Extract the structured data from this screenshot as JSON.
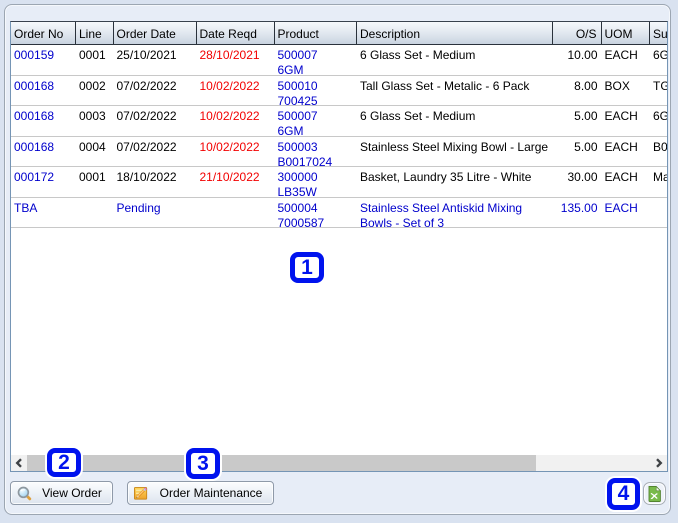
{
  "colors": {
    "outer_bg": "#d9e2f0",
    "panel_bg": "#e7edf7",
    "link_blue": "#0000cc",
    "overdue_red": "#f20000",
    "annotation_blue": "#0013ee",
    "excel_green": "#74b84a"
  },
  "grid": {
    "columns": [
      {
        "label": "Order No"
      },
      {
        "label": "Line"
      },
      {
        "label": "Order Date"
      },
      {
        "label": "Date Reqd"
      },
      {
        "label": "Product"
      },
      {
        "label": "Description"
      },
      {
        "label": "O/S",
        "align": "right"
      },
      {
        "label": "UOM"
      },
      {
        "label": "Su"
      }
    ],
    "rows": [
      {
        "cells": [
          {
            "t": "000159",
            "c": "blue"
          },
          {
            "t": "0001"
          },
          {
            "t": "25/10/2021"
          },
          {
            "t": "28/10/2021",
            "c": "red"
          },
          {
            "t": "500007\n6GM",
            "c": "blue"
          },
          {
            "t": "6 Glass Set - Medium"
          },
          {
            "t": "10.00"
          },
          {
            "t": "EACH"
          },
          {
            "t": "6G"
          }
        ]
      },
      {
        "cells": [
          {
            "t": "000168",
            "c": "blue"
          },
          {
            "t": "0002"
          },
          {
            "t": "07/02/2022"
          },
          {
            "t": "10/02/2022",
            "c": "red"
          },
          {
            "t": "500010\n700425",
            "c": "blue"
          },
          {
            "t": "Tall Glass Set - Metalic - 6 Pack"
          },
          {
            "t": "8.00"
          },
          {
            "t": "BOX"
          },
          {
            "t": "TG"
          }
        ]
      },
      {
        "cells": [
          {
            "t": "000168",
            "c": "blue"
          },
          {
            "t": "0003"
          },
          {
            "t": "07/02/2022"
          },
          {
            "t": "10/02/2022",
            "c": "red"
          },
          {
            "t": "500007\n6GM",
            "c": "blue"
          },
          {
            "t": "6 Glass Set - Medium"
          },
          {
            "t": "5.00"
          },
          {
            "t": "EACH"
          },
          {
            "t": "6G"
          }
        ]
      },
      {
        "cells": [
          {
            "t": "000168",
            "c": "blue"
          },
          {
            "t": "0004"
          },
          {
            "t": "07/02/2022"
          },
          {
            "t": "10/02/2022",
            "c": "red"
          },
          {
            "t": "500003\nB0017024",
            "c": "blue"
          },
          {
            "t": "Stainless Steel Mixing Bowl - Large"
          },
          {
            "t": "5.00"
          },
          {
            "t": "EACH"
          },
          {
            "t": "B0"
          }
        ]
      },
      {
        "cells": [
          {
            "t": "000172",
            "c": "blue"
          },
          {
            "t": "0001"
          },
          {
            "t": "18/10/2022"
          },
          {
            "t": "21/10/2022",
            "c": "red"
          },
          {
            "t": "300000\nLB35W",
            "c": "blue"
          },
          {
            "t": "Basket, Laundry 35 Litre - White"
          },
          {
            "t": "30.00"
          },
          {
            "t": "EACH"
          },
          {
            "t": "Ma"
          }
        ]
      },
      {
        "all_blue": true,
        "cells": [
          {
            "t": "TBA",
            "c": "blue"
          },
          {
            "t": ""
          },
          {
            "t": "Pending",
            "c": "blue"
          },
          {
            "t": ""
          },
          {
            "t": "500004\n7000587",
            "c": "blue"
          },
          {
            "t": "Stainless Steel Antiskid Mixing Bowls - Set of 3",
            "c": "blue"
          },
          {
            "t": "135.00",
            "c": "blue"
          },
          {
            "t": "EACH",
            "c": "blue"
          },
          {
            "t": ""
          }
        ]
      }
    ]
  },
  "toolbar": {
    "view_order_label": "View Order",
    "order_maintenance_label": "Order Maintenance"
  },
  "annotations": [
    {
      "label": "1"
    },
    {
      "label": "2"
    },
    {
      "label": "3"
    },
    {
      "label": "4"
    }
  ]
}
